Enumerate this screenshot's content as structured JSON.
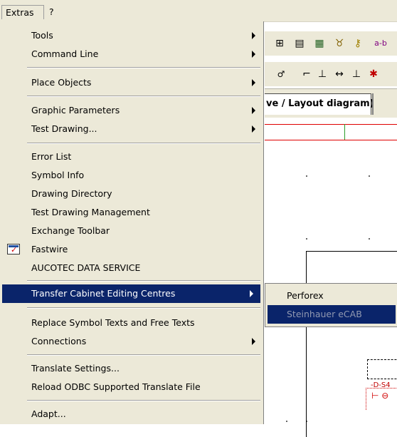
{
  "menubar": {
    "items": [
      "Extras",
      "?"
    ]
  },
  "toolbar_icons": [
    "plug-icon",
    "panel-icon",
    "grid-icon",
    "wrench-icon",
    "key-icon",
    "label-icon"
  ],
  "toolbar_row1_text": "a-b",
  "toolbar2_icons": [
    "connect-icon",
    "line-icon",
    "align-icon",
    "dimension-icon",
    "distribute-icon",
    "star-icon"
  ],
  "tab": {
    "label": "ve / Layout diagram)"
  },
  "canvas": {
    "device_label": "-D-S4"
  },
  "menu": {
    "items": [
      {
        "label": "Tools",
        "submenu": true
      },
      {
        "label": "Command Line",
        "submenu": true
      },
      {
        "label": "Place Objects",
        "submenu": true
      },
      {
        "label": "Graphic Parameters",
        "submenu": true
      },
      {
        "label": "Test Drawing...",
        "submenu": true
      },
      {
        "label": "Error List",
        "submenu": false
      },
      {
        "label": "Symbol Info",
        "submenu": false
      },
      {
        "label": "Drawing Directory",
        "submenu": false
      },
      {
        "label": "Test Drawing Management",
        "submenu": false
      },
      {
        "label": "Exchange Toolbar",
        "submenu": false
      },
      {
        "label": "Fastwire",
        "submenu": false,
        "icon": "fastwire-icon"
      },
      {
        "label": "AUCOTEC DATA SERVICE",
        "submenu": false
      },
      {
        "label": "Transfer Cabinet Editing Centres",
        "submenu": true,
        "highlighted": true
      },
      {
        "label": "Replace Symbol Texts and Free Texts",
        "submenu": false
      },
      {
        "label": "Connections",
        "submenu": true
      },
      {
        "label": "Translate Settings...",
        "submenu": false
      },
      {
        "label": "Reload ODBC Supported Translate File",
        "submenu": false
      },
      {
        "label": "Adapt...",
        "submenu": false
      }
    ]
  },
  "submenu": {
    "items": [
      {
        "label": "Perforex",
        "enabled": true
      },
      {
        "label": "Steinhauer eCAB",
        "enabled": false,
        "highlighted": true
      }
    ]
  },
  "colors": {
    "menu_bg": "#ece9d8",
    "highlight": "#0a246a",
    "disabled_text": "#9098b0"
  }
}
